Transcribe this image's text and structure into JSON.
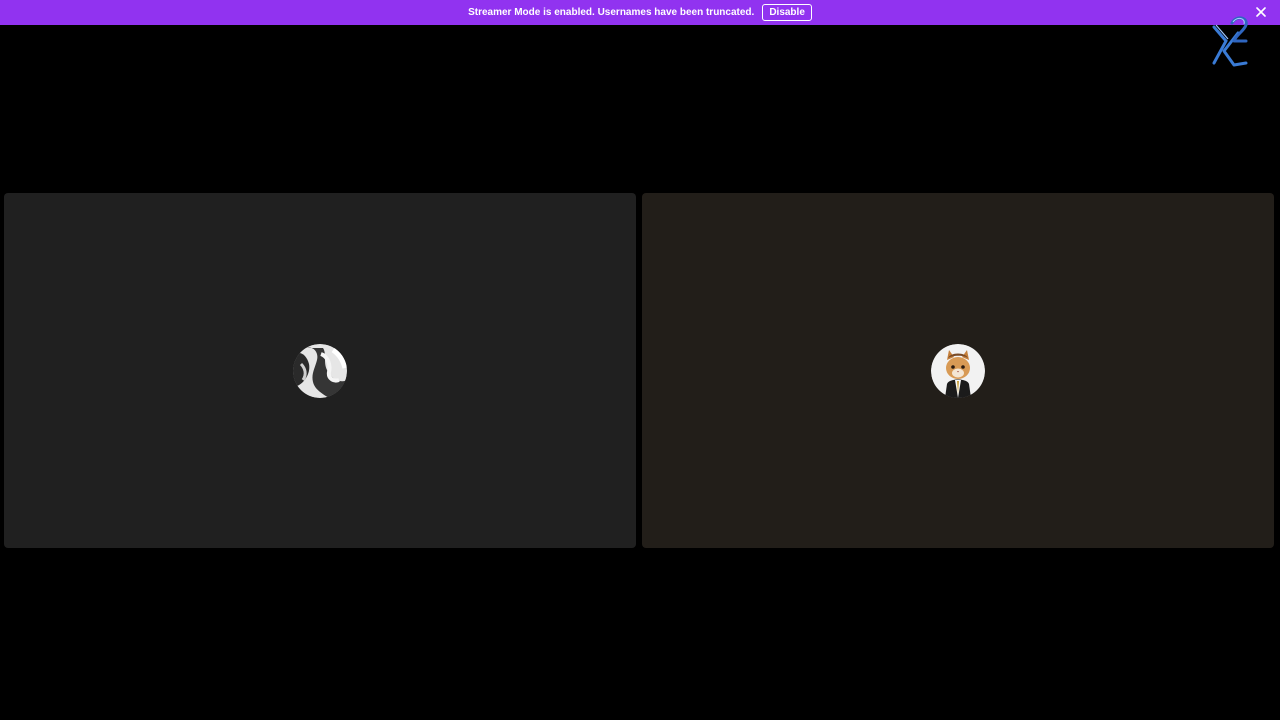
{
  "banner": {
    "message": "Streamer Mode is enabled. Usernames have been truncated.",
    "disable_label": "Disable",
    "close_icon": "close-icon",
    "color": "#9133f0"
  },
  "overlay": {
    "logo_icon": "x2-logo-icon"
  },
  "call": {
    "participants": [
      {
        "tile_color": "#202020",
        "avatar": "grayscale-photo-avatar"
      },
      {
        "tile_color": "#221e19",
        "avatar": "cat-in-suit-avatar"
      }
    ]
  }
}
